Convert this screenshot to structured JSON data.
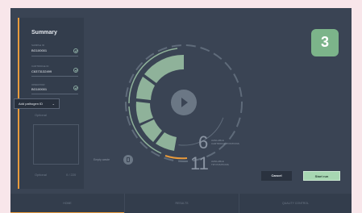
{
  "step": {
    "number": "3"
  },
  "summary": {
    "title": "Summary",
    "fields": [
      {
        "label": "Sample ID",
        "value": "BG100001"
      },
      {
        "label": "Cartridge ID",
        "value": "C6373132499"
      },
      {
        "label": "Operator",
        "value": "BG100001"
      }
    ],
    "pathogen_dropdown": "Add pathogen ID",
    "optional_1": "Optional",
    "notes_placeholder": "Optional",
    "char_count": "0 / 220"
  },
  "gauge": {
    "cartridge_count": "6",
    "cartridge_label_1": "Available",
    "cartridge_label_2": "Cartridge positions",
    "tip_count": "11",
    "tip_label_1": "Available",
    "tip_label_2": "Tip positions",
    "accent_color": "#e89a3c",
    "segment_color": "#8fb29a"
  },
  "waste": {
    "label": "Empty waste"
  },
  "actions": {
    "cancel": "Cancel",
    "start": "Start run"
  },
  "nav": {
    "items": [
      "Home",
      "Results",
      "Quality control"
    ]
  }
}
